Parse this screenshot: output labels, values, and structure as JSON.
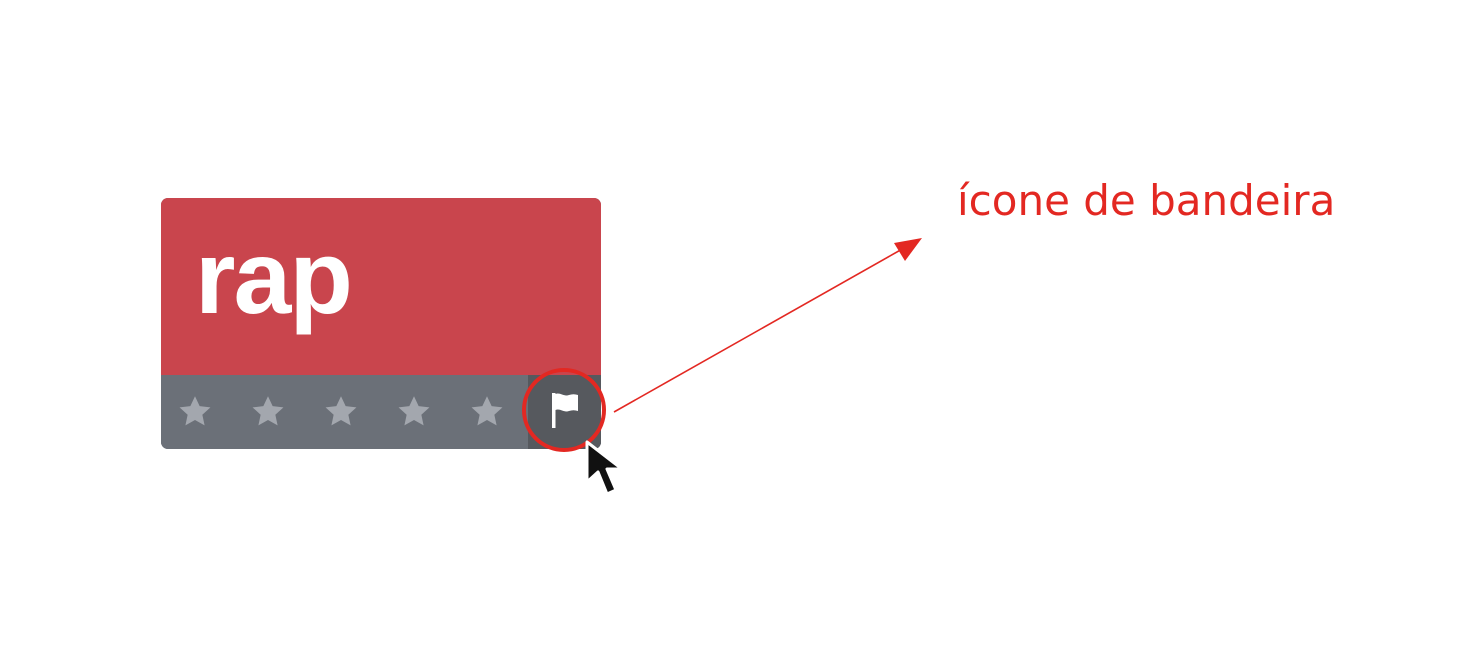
{
  "tile": {
    "title": "rap",
    "background_color": "#c9454d",
    "footer_color": "#6b7078",
    "rating": {
      "max_stars": 5,
      "filled_stars": 0,
      "star_icon": "star-icon",
      "star_color": "#a3a7ae"
    },
    "flag_button": {
      "icon": "flag-icon",
      "background_color": "#56595e"
    }
  },
  "annotation": {
    "label": "ícone de bandeira",
    "color": "#e32822"
  }
}
